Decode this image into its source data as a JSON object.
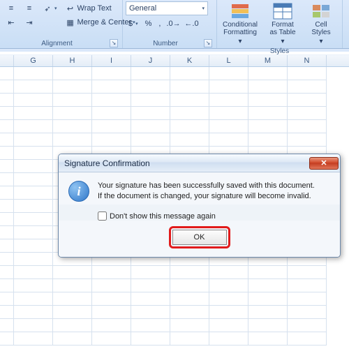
{
  "ribbon": {
    "alignment": {
      "wrap_text": "Wrap Text",
      "merge_center": "Merge & Center",
      "label": "Alignment"
    },
    "number": {
      "format_name": "General",
      "currency": "$",
      "percent": "%",
      "comma": ",",
      "label": "Number"
    },
    "styles": {
      "conditional": "Conditional\nFormatting",
      "format_table": "Format\nas Table",
      "cell_styles": "Cell\nStyles",
      "label": "Styles"
    }
  },
  "columns": [
    "G",
    "H",
    "I",
    "J",
    "K",
    "L",
    "M",
    "N"
  ],
  "dialog": {
    "title": "Signature Confirmation",
    "message_line1": "Your signature has been successfully saved with this document.",
    "message_line2": "If the document is changed, your signature will become invalid.",
    "checkbox_label": "Don't show this message again",
    "ok": "OK"
  }
}
